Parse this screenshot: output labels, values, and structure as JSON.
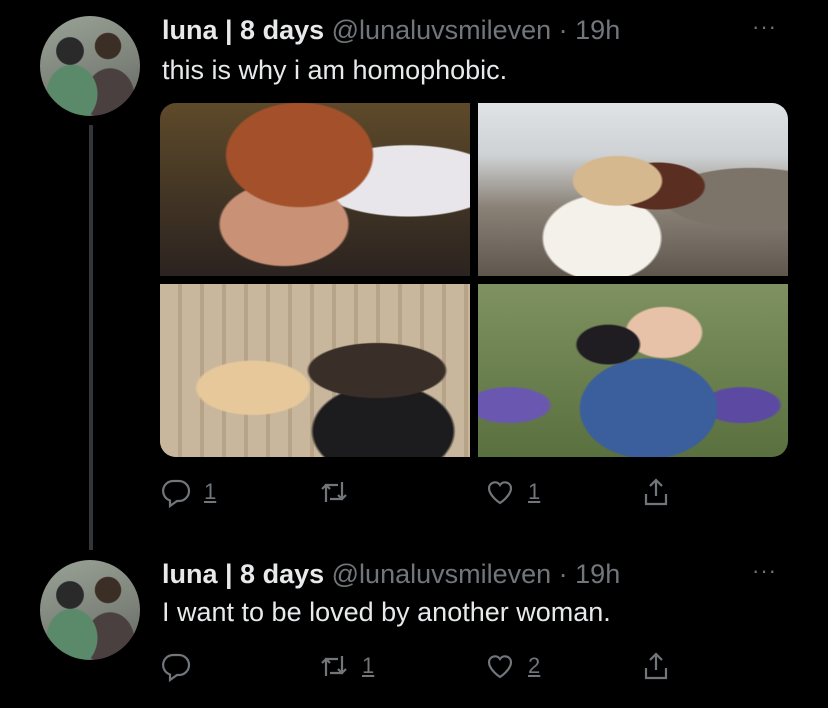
{
  "tweets": [
    {
      "name": "luna | 8 days",
      "handle": "@lunaluvsmileven",
      "time": "19h",
      "text": "this is why i am homophobic.",
      "replies": "1",
      "retweets": "",
      "likes": "1",
      "more": "···"
    },
    {
      "name": "luna | 8 days",
      "handle": "@lunaluvsmileven",
      "time": "19h",
      "text": "I want to be loved by another woman.",
      "replies": "",
      "retweets": "1",
      "likes": "2",
      "more": "···"
    }
  ],
  "separator": " · ",
  "icons": {
    "reply": "reply-icon",
    "retweet": "retweet-icon",
    "like": "heart-icon",
    "share": "share-icon"
  },
  "colors": {
    "background": "#000000",
    "text": "#e7e9ea",
    "secondary": "#71767b",
    "thread_line": "#333639"
  }
}
